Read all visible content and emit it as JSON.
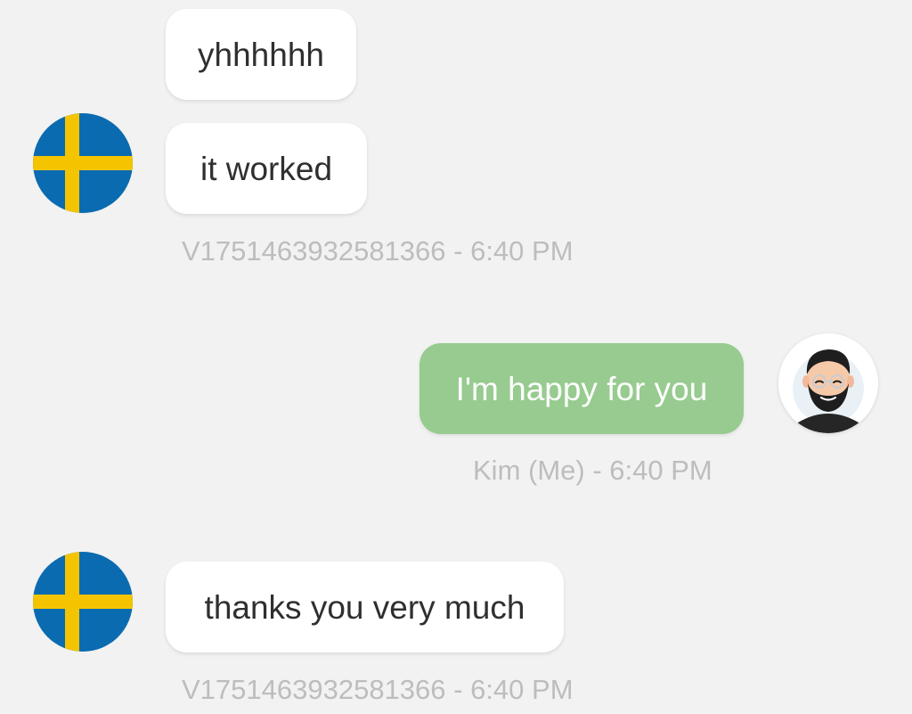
{
  "colors": {
    "background": "#f2f2f2",
    "incoming_bubble": "#ffffff",
    "outgoing_bubble": "#97cb8f",
    "meta_text": "#bdbdbd",
    "flag_blue": "#0a6bb0",
    "flag_yellow": "#f5c400"
  },
  "messages": [
    {
      "text": "yhhhhhh"
    },
    {
      "text": "it worked"
    },
    {
      "text": "V1751463932581366 - 6:40 PM"
    },
    {
      "text": "I'm happy for you"
    },
    {
      "text": "Kim (Me) - 6:40 PM"
    },
    {
      "text": "thanks you very much"
    },
    {
      "text": "V1751463932581366 - 6:40 PM"
    }
  ],
  "avatars": {
    "other": "sweden-flag-avatar",
    "me": "bearded-man-avatar"
  }
}
